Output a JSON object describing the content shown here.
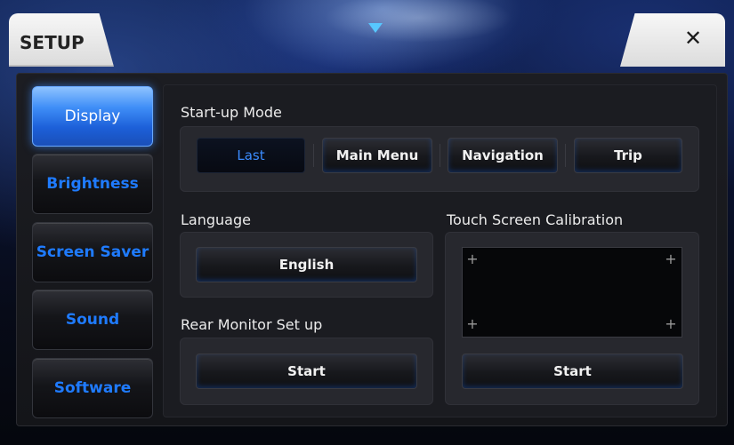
{
  "header": {
    "title": "SETUP",
    "close_label": "✕"
  },
  "sidebar": {
    "items": [
      {
        "label": "Display",
        "active": true
      },
      {
        "label": "Brightness",
        "active": false
      },
      {
        "label": "Screen Saver",
        "active": false
      },
      {
        "label": "Sound",
        "active": false
      },
      {
        "label": "Software",
        "active": false
      }
    ]
  },
  "startup_mode": {
    "title": "Start-up Mode",
    "options": [
      "Last",
      "Main Menu",
      "Navigation",
      "Trip"
    ],
    "selected": "Last"
  },
  "language": {
    "title": "Language",
    "value": "English"
  },
  "rear_monitor": {
    "title": "Rear Monitor Set up",
    "button_label": "Start"
  },
  "calibration": {
    "title": "Touch Screen Calibration",
    "button_label": "Start",
    "mark": "+"
  },
  "colors": {
    "accent": "#1f7bff",
    "active_tab": "#3f8ef7",
    "pulldown": "#57c7ff"
  },
  "icons": [
    "close-icon",
    "pulldown-arrow-icon",
    "calibration-crosshair-icon"
  ]
}
